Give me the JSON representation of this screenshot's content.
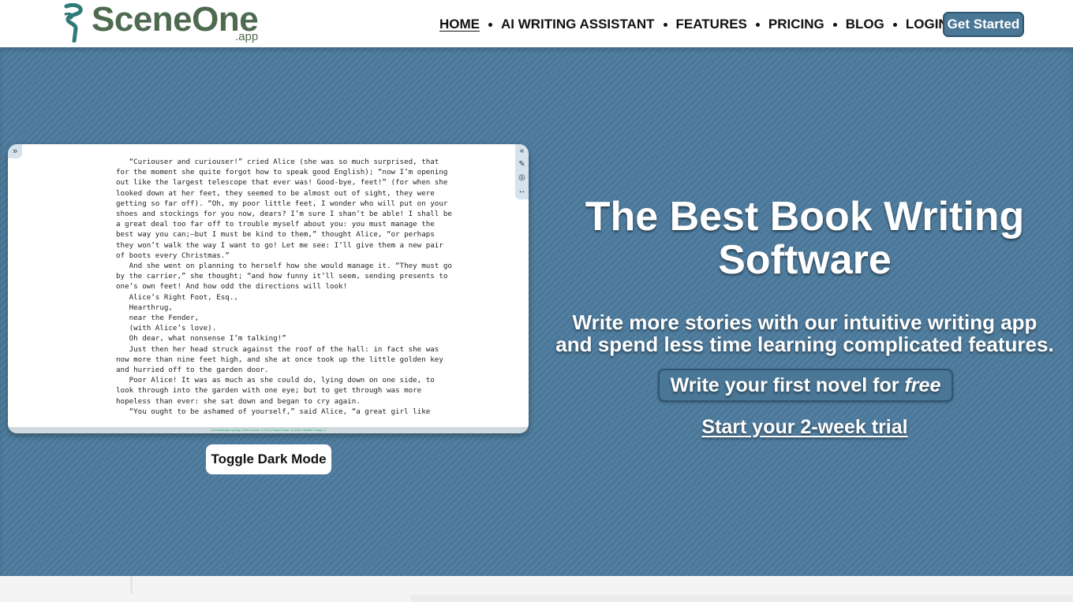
{
  "brand": {
    "name": "SceneOne",
    "suffix": ".app"
  },
  "nav": {
    "items": [
      {
        "label": "HOME",
        "active": true
      },
      {
        "label": "AI WRITING ASSISTANT"
      },
      {
        "label": "FEATURES"
      },
      {
        "label": "PRICING"
      },
      {
        "label": "BLOG"
      },
      {
        "label": "LOGIN"
      }
    ],
    "cta": "Get Started"
  },
  "preview": {
    "lines": [
      "   “Curiouser and curiouser!” cried Alice (she was so much surprised, that",
      "for the moment she quite forgot how to speak good English); “now I’m opening",
      "out like the largest telescope that ever was! Good-bye, feet!” (for when she",
      "looked down at her feet, they seemed to be almost out of sight, they were",
      "getting so far off). “Oh, my poor little feet, I wonder who will put on your",
      "shoes and stockings for you now, dears? I’m sure I shan’t be able! I shall be",
      "a great deal too far off to trouble myself about you: you must manage the",
      "best way you can;—but I must be kind to them,” thought Alice, “or perhaps",
      "they won’t walk the way I want to go! Let me see: I’ll give them a new pair",
      "of boots every Christmas.”",
      "   And she went on planning to herself how she would manage it. “They must go",
      "by the carrier,” she thought; “and how funny it’ll seem, sending presents to",
      "one’s own feet! And how odd the directions will look!",
      "   Alice’s Right Foot, Esq.,",
      "   Hearthrug,",
      "   near the Fender,",
      "   (with Alice’s love).",
      "   Oh dear, what nonsense I’m talking!”",
      "   Just then her head struck against the roof of the hall: in fact she was",
      "now more than nine feet high, and she at once took up the little golden key",
      "and hurried off to the garden door.",
      "   Poor Alice! It was as much as she could do, lying down on one side, to",
      "look through into the garden with one eye; but to get through was more",
      "hopeless than ever: she sat down and began to cry again.",
      "   “You ought to be ashamed of yourself,” said Alice, “a great girl like"
    ],
    "status": "Automatically saving | Word Count: 2,276 | Project Total: 21,818 | Written Today: 0",
    "toggle_dark": "Toggle Dark Mode"
  },
  "hero": {
    "headline": "The Best Book Writing Software",
    "subline": "Write more stories with our intuitive writing app and spend less time learning complicated features.",
    "cta_free_prefix": "Write your first novel for",
    "cta_free_em": "free",
    "cta_trial": "Start your 2-week trial"
  },
  "colors": {
    "hero_bg": "#4d7b9e",
    "brand_green": "#4f6b4f",
    "button_blue": "#4a7796"
  }
}
